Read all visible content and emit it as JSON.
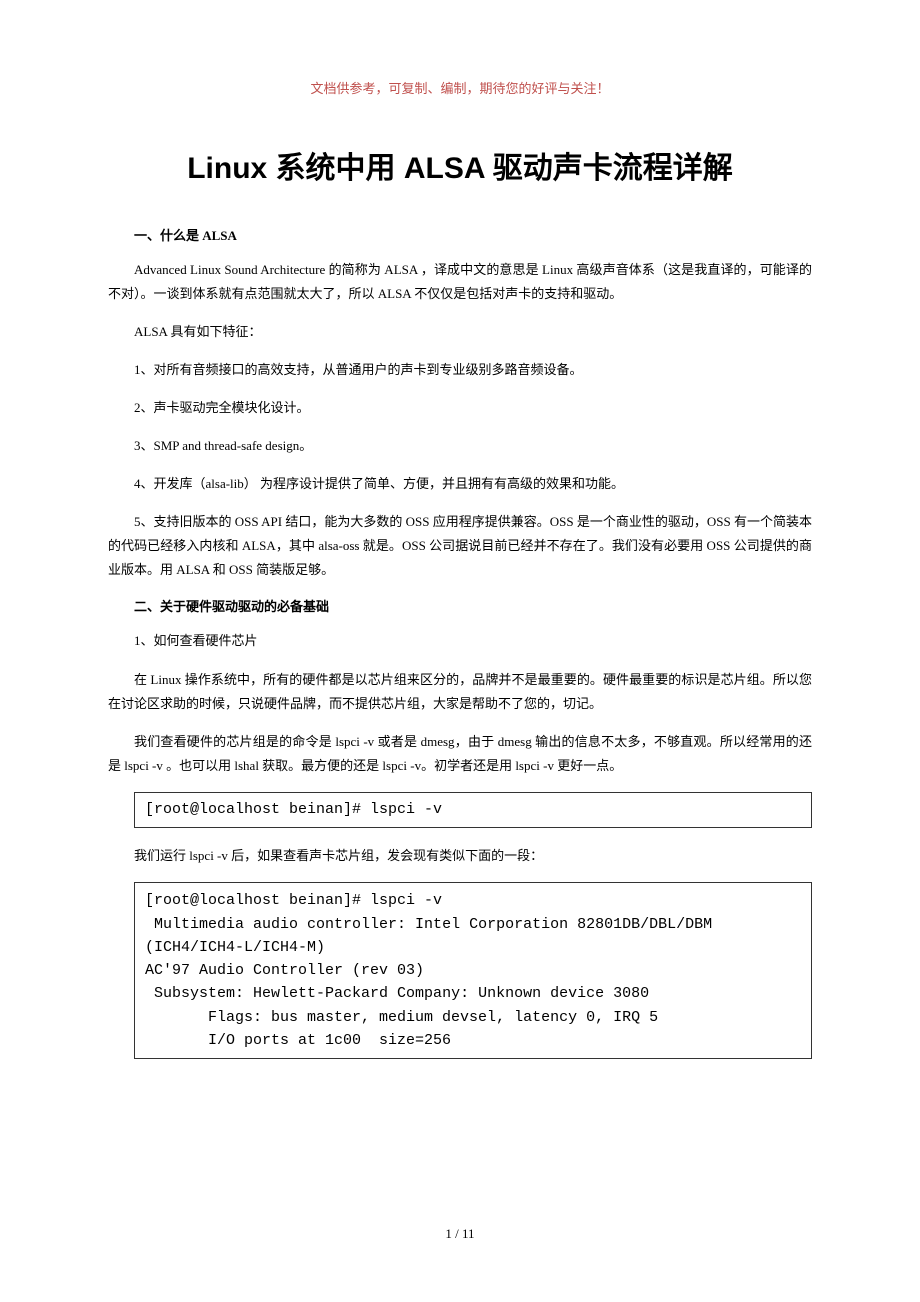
{
  "header_note": "文档供参考，可复制、编制，期待您的好评与关注！",
  "title": "Linux 系统中用 ALSA 驱动声卡流程详解",
  "section1_heading": "一、什么是 ALSA",
  "para1": "Advanced Linux Sound Architecture 的简称为 ALSA ，译成中文的意思是 Linux 高级声音体系（这是我直译的，可能译的不对）。一谈到体系就有点范围就太大了，所以 ALSA 不仅仅是包括对声卡的支持和驱动。",
  "para2": "ALSA 具有如下特征：",
  "para3": "1、对所有音频接口的高效支持，从普通用户的声卡到专业级别多路音频设备。",
  "para4": "2、声卡驱动完全模块化设计。",
  "para5": "3、SMP and thread-safe design。",
  "para6": "4、开发库（alsa-lib） 为程序设计提供了简单、方便，并且拥有有高级的效果和功能。",
  "para7": "5、支持旧版本的 OSS API 结口，能为大多数的 OSS 应用程序提供兼容。OSS 是一个商业性的驱动，OSS 有一个简装本的代码已经移入内核和 ALSA，其中 alsa-oss 就是。OSS 公司据说目前已经并不存在了。我们没有必要用 OSS 公司提供的商业版本。用 ALSA 和 OSS 简装版足够。",
  "section2_heading": "二、关于硬件驱动驱动的必备基础",
  "para8": "1、如何查看硬件芯片",
  "para9": "在 Linux 操作系统中，所有的硬件都是以芯片组来区分的，品牌并不是最重要的。硬件最重要的标识是芯片组。所以您在讨论区求助的时候，只说硬件品牌，而不提供芯片组，大家是帮助不了您的，切记。",
  "para10": "我们查看硬件的芯片组是的命令是 lspci -v 或者是 dmesg，由于 dmesg 输出的信息不太多，不够直观。所以经常用的还是 lspci -v 。也可以用 lshal 获取。最方便的还是 lspci -v。初学者还是用 lspci -v 更好一点。",
  "code1": "[root@localhost beinan]# lspci -v",
  "para11": "我们运行 lspci -v 后，如果查看声卡芯片组，发会现有类似下面的一段：",
  "code2": "[root@localhost beinan]# lspci -v\n Multimedia audio controller: Intel Corporation 82801DB/DBL/DBM (ICH4/ICH4-L/ICH4-M)\nAC'97 Audio Controller (rev 03)\n Subsystem: Hewlett-Packard Company: Unknown device 3080\n       Flags: bus master, medium devsel, latency 0, IRQ 5\n       I/O ports at 1c00  size=256",
  "footer": "1 / 11"
}
